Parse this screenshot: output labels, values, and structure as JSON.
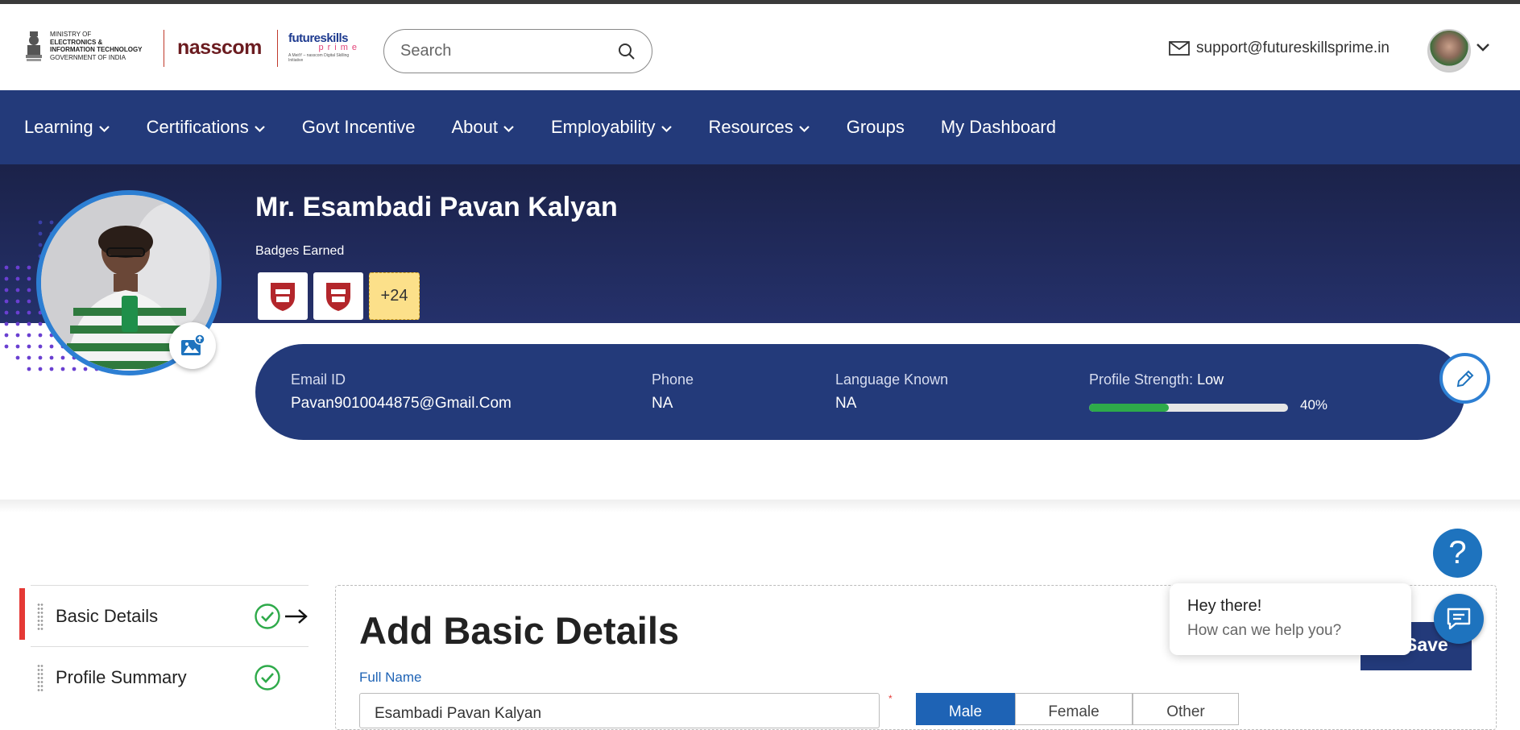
{
  "header": {
    "gov_logo_text": [
      "MINISTRY OF",
      "ELECTRONICS &",
      "INFORMATION TECHNOLOGY",
      "GOVERNMENT OF INDIA"
    ],
    "nasscom_logo": "nasscom",
    "futureskills_logo": "futureskills",
    "futureskills_sub": "prime",
    "futureskills_tag": "A MeitY – nasscom Digital Skilling Initiative",
    "search_placeholder": "Search",
    "support_email": "support@futureskillsprime.in"
  },
  "nav": {
    "items": [
      {
        "label": "Learning",
        "dropdown": true
      },
      {
        "label": "Certifications",
        "dropdown": true
      },
      {
        "label": "Govt Incentive",
        "dropdown": false
      },
      {
        "label": "About",
        "dropdown": true
      },
      {
        "label": "Employability",
        "dropdown": true
      },
      {
        "label": "Resources",
        "dropdown": true
      },
      {
        "label": "Groups",
        "dropdown": false
      },
      {
        "label": "My Dashboard",
        "dropdown": false
      }
    ]
  },
  "profile": {
    "name": "Mr. Esambadi Pavan Kalyan",
    "badges_label": "Badges Earned",
    "badges_more": "+24",
    "email_label": "Email ID",
    "email": "Pavan9010044875@Gmail.Com",
    "phone_label": "Phone",
    "phone": "NA",
    "language_label": "Language Known",
    "language": "NA",
    "strength_label": "Profile Strength: ",
    "strength_value": "Low",
    "strength_percent_text": "40%",
    "strength_fraction": 0.4
  },
  "sidebar": {
    "items": [
      {
        "label": "Basic Details",
        "complete": true,
        "active": true
      },
      {
        "label": "Profile Summary",
        "complete": true,
        "active": false
      }
    ]
  },
  "form": {
    "title": "Add Basic Details",
    "fullname_label": "Full Name",
    "fullname_value": "Esambadi Pavan Kalyan",
    "required_mark": "*",
    "gender_options": [
      "Male",
      "Female",
      "Other"
    ],
    "gender_selected": "Male",
    "save_label": "Save"
  },
  "chat": {
    "title": "Hey there!",
    "subtitle": "How can we help you?",
    "help_symbol": "?"
  },
  "colors": {
    "nav_bg": "#233a7a",
    "banner_bg": "#1b2249",
    "accent_blue": "#1e73be",
    "progress_green": "#2eaa4a",
    "active_red": "#e53935"
  },
  "icons": [
    "search-icon",
    "mail-icon",
    "chevron-down-icon",
    "upload-photo-icon",
    "pencil-icon",
    "check-circle-icon",
    "arrow-right-icon",
    "chat-icon",
    "help-icon"
  ]
}
